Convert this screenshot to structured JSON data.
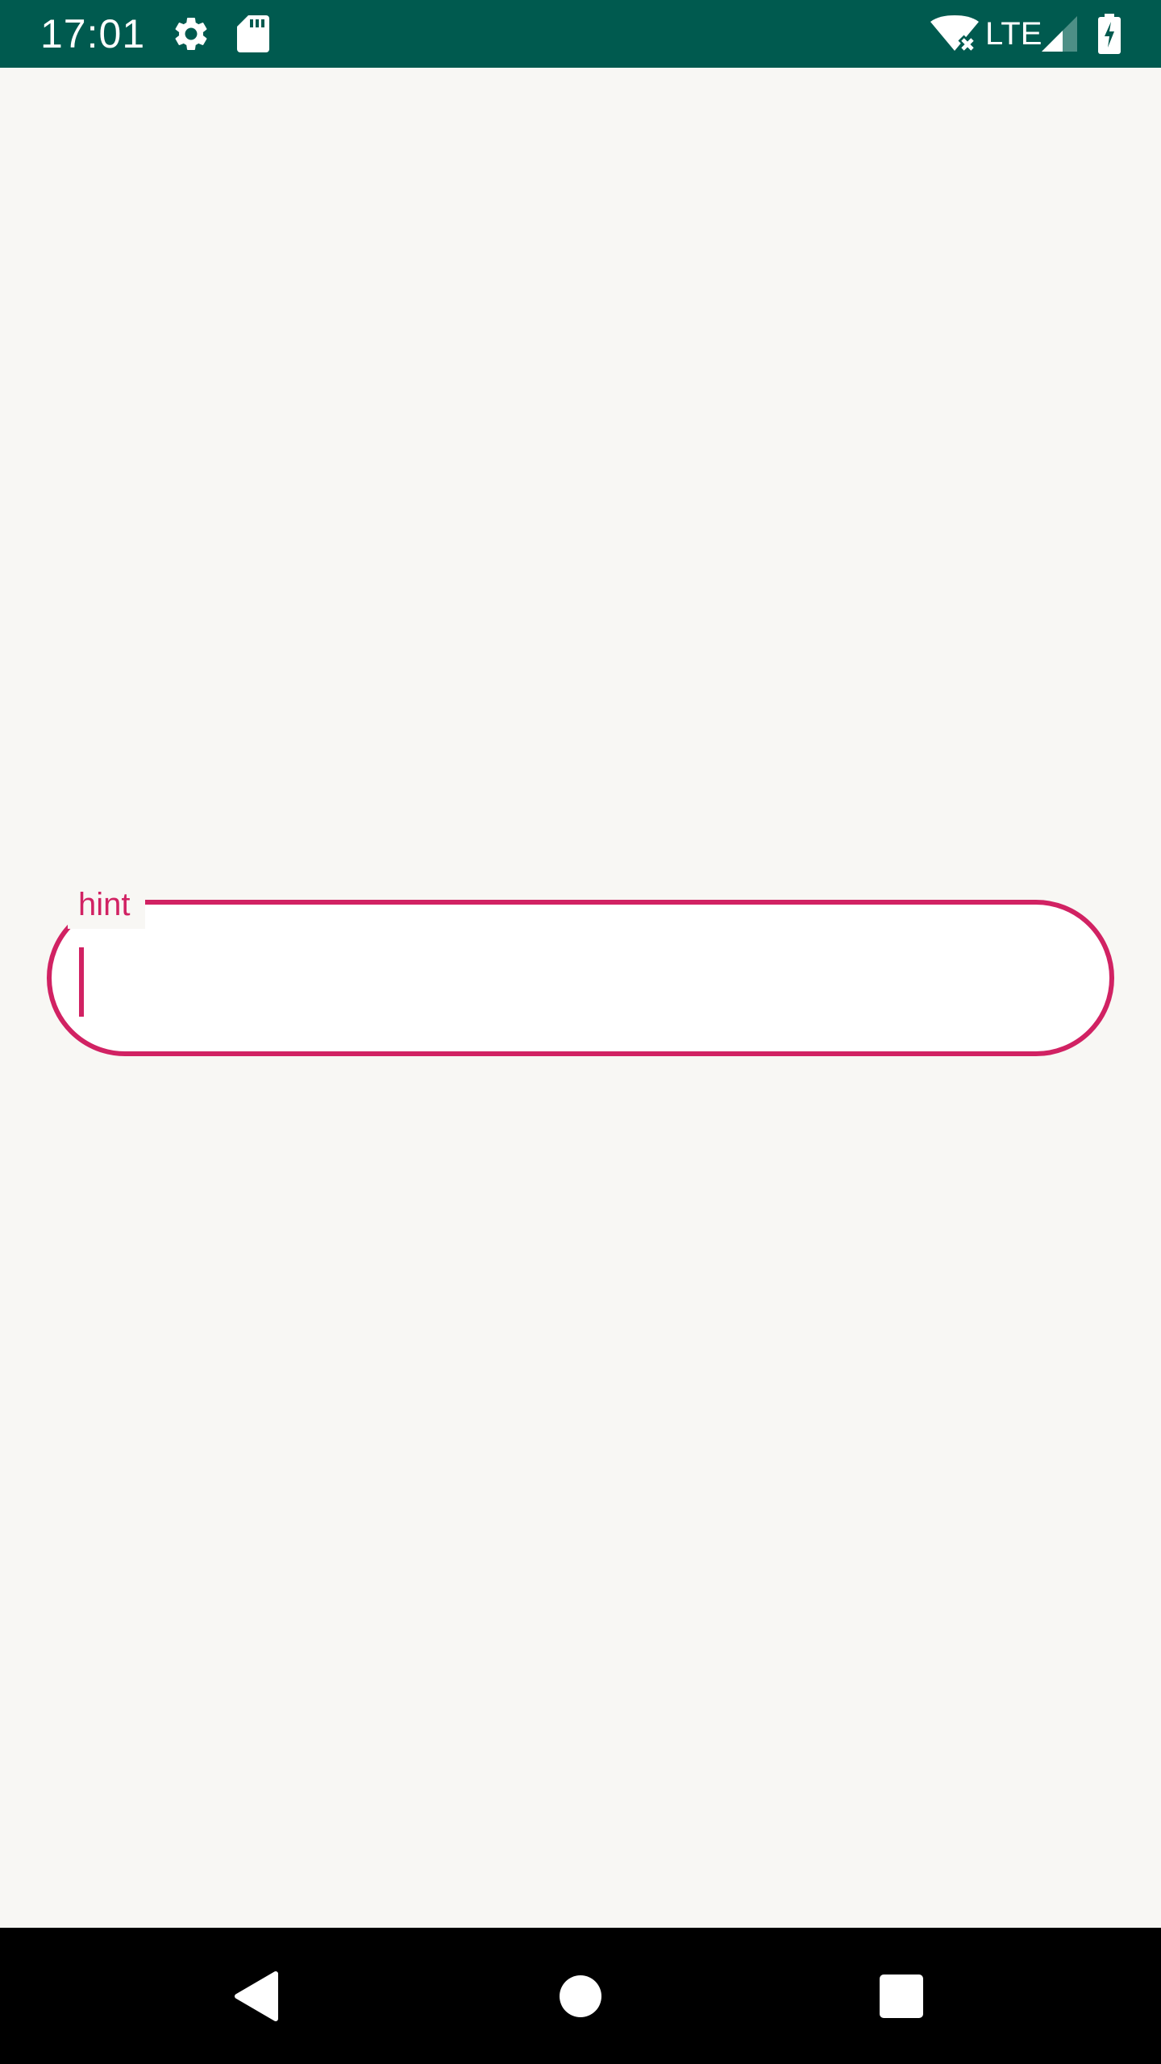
{
  "status_bar": {
    "time": "17:01",
    "network": "LTE",
    "background_color": "#005A4F",
    "icons": [
      "settings-icon",
      "sd-card-icon",
      "wifi-off-icon",
      "signal-icon",
      "battery-charging-icon"
    ]
  },
  "text_field": {
    "hint": "hint",
    "value": "",
    "accent_color": "#D12263"
  },
  "nav_bar": {
    "icons": [
      "back-icon",
      "home-icon",
      "recents-icon"
    ]
  },
  "colors": {
    "background": "#F8F7F4",
    "accent": "#D12263",
    "status_bar": "#005A4F",
    "nav_bar": "#000000"
  }
}
